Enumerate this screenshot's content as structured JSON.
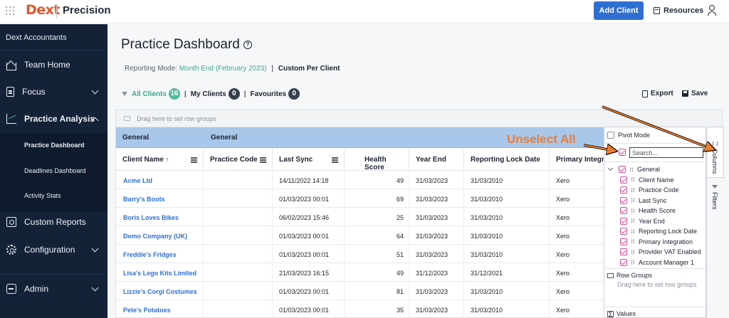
{
  "topbar": {
    "logo": "Dext",
    "product": "Precision",
    "add_client": "Add Client",
    "resources": "Resources"
  },
  "sidebar": {
    "org": "Dext Accountants",
    "items": [
      {
        "label": "Team Home",
        "icon": "home-icon"
      },
      {
        "label": "Focus",
        "icon": "clipboard-icon"
      },
      {
        "label": "Practice Analysis",
        "icon": "line-chart-icon"
      },
      {
        "label": "Custom Reports",
        "icon": "report-icon"
      },
      {
        "label": "Configuration",
        "icon": "gear-icon"
      },
      {
        "label": "Admin",
        "icon": "admin-icon"
      }
    ],
    "sub_items": [
      "Practice Dashboard",
      "Deadlines Dashboard",
      "Activity Stats"
    ]
  },
  "main": {
    "title": "Practice Dashboard",
    "reporting_prefix": "Reporting Mode:",
    "reporting_mode": "Month End (February 2023)",
    "reporting_sep": "|",
    "reporting_custom": "Custom Per Client",
    "filters": {
      "all_label": "All Clients",
      "all_count": "16",
      "sep1": "|",
      "my_label": "My Clients",
      "my_count": "0",
      "sep2": "|",
      "fav_label": "Favourites",
      "fav_count": "0"
    },
    "export": "Export",
    "save": "Save"
  },
  "grid": {
    "group_drop_text": "Drag here to set row groups",
    "group_headers": [
      "General",
      "General"
    ],
    "columns": [
      "Client Name",
      "Practice Code",
      "Last Sync",
      "Health Score",
      "Year End",
      "Reporting Lock Date",
      "Primary Integrat"
    ],
    "sort_arrow": "↑",
    "rows": [
      {
        "name": "Acme Ltd",
        "code": "",
        "sync": "14/11/2022 14:18",
        "health": "49",
        "year_end": "31/03/2023",
        "lock": "31/03/2010",
        "integration": "Xero"
      },
      {
        "name": "Barry's Boots",
        "code": "",
        "sync": "01/03/2023 00:01",
        "health": "69",
        "year_end": "31/03/2023",
        "lock": "31/03/2010",
        "integration": "Xero"
      },
      {
        "name": "Boris Loves Bikes",
        "code": "",
        "sync": "06/02/2023 15:46",
        "health": "25",
        "year_end": "31/03/2023",
        "lock": "31/03/2010",
        "integration": "Xero"
      },
      {
        "name": "Demo Company (UK)",
        "code": "",
        "sync": "01/03/2023 00:01",
        "health": "64",
        "year_end": "31/03/2023",
        "lock": "31/03/2010",
        "integration": "Xero"
      },
      {
        "name": "Freddie's Fridges",
        "code": "",
        "sync": "01/03/2023 00:01",
        "health": "51",
        "year_end": "31/03/2023",
        "lock": "31/03/2010",
        "integration": "Xero"
      },
      {
        "name": "Lisa's Lego Kits Limited",
        "code": "",
        "sync": "21/03/2023 16:15",
        "health": "49",
        "year_end": "31/12/2023",
        "lock": "31/12/2021",
        "integration": "Xero"
      },
      {
        "name": "Lizzie's Corgi Costumes",
        "code": "",
        "sync": "01/03/2023 00:01",
        "health": "81",
        "year_end": "31/03/2023",
        "lock": "31/03/2010",
        "integration": "Xero"
      },
      {
        "name": "Pete's Potatoes",
        "code": "",
        "sync": "01/03/2023 00:01",
        "health": "35",
        "year_end": "31/03/2023",
        "lock": "31/03/2010",
        "integration": "Xero"
      }
    ]
  },
  "tool_panel": {
    "pivot_mode": "Pivot Mode",
    "search_placeholder": "Search...",
    "columns": [
      "General",
      "Client Name",
      "Practice Code",
      "Last Sync",
      "Health Score",
      "Year End",
      "Reporting Lock Date",
      "Primary Integration",
      "Provider VAT Enabled",
      "Account Manager 1"
    ],
    "row_groups": "Row Groups",
    "row_groups_drop": "Drag here to set row groups",
    "values": "Values",
    "tabs": [
      "Columns",
      "Filters"
    ],
    "accent_color": "#d54f9a"
  },
  "annotation": {
    "text": "Unselect All",
    "color": "#ed7d31"
  }
}
